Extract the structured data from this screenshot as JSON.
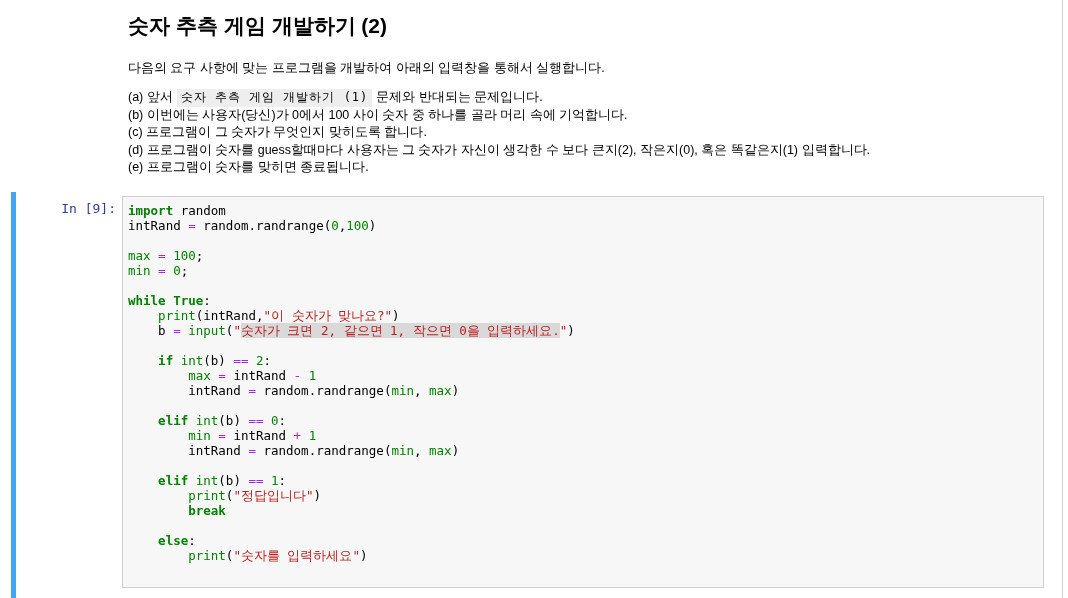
{
  "title": "숫자 추측 게임 개발하기 (2)",
  "intro": "다음의 요구 사항에 맞는 프로그램을 개발하여 아래의 입력창을 통해서 실행합니다.",
  "requirements": [
    {
      "parts": [
        {
          "kind": "text",
          "text": "(a) 앞서"
        },
        {
          "kind": "code",
          "text": "숫자 추측 게임 개발하기 (1)"
        },
        {
          "kind": "text",
          "text": "문제와 반대되는 문제입니다."
        }
      ]
    },
    {
      "parts": [
        {
          "kind": "text",
          "text": "(b) 이번에는 사용자(당신)가 0에서 100 사이 숫자 중 하나를 골라 머리 속에 기억합니다."
        }
      ]
    },
    {
      "parts": [
        {
          "kind": "text",
          "text": "(c) 프로그램이 그 숫자가 무엇인지 맞히도록 합니다."
        }
      ]
    },
    {
      "parts": [
        {
          "kind": "text",
          "text": "(d) 프로그램이 숫자를 guess할때마다 사용자는 그 숫자가 자신이 생각한 수 보다 큰지(2), 작은지(0), 혹은 똑같은지(1) 입력합니다."
        }
      ]
    },
    {
      "parts": [
        {
          "kind": "text",
          "text": "(e) 프로그램이 숫자를 맞히면 종료됩니다."
        }
      ]
    }
  ],
  "cell": {
    "prompt": "In [9]:",
    "active": true,
    "blocks": [
      [
        [
          {
            "kind": "kw",
            "text": "import"
          },
          {
            "kind": "name",
            "text": " random"
          }
        ],
        [
          {
            "kind": "name",
            "text": "intRand "
          },
          {
            "kind": "op",
            "text": "="
          },
          {
            "kind": "name",
            "text": " random.randrange("
          },
          {
            "kind": "num",
            "text": "0"
          },
          {
            "kind": "name",
            "text": ","
          },
          {
            "kind": "num",
            "text": "100"
          },
          {
            "kind": "name",
            "text": ")"
          }
        ]
      ],
      [
        [
          {
            "kind": "builtin",
            "text": "max"
          },
          {
            "kind": "op",
            "text": " ="
          },
          {
            "kind": "num",
            "text": " 100"
          },
          {
            "kind": "name",
            "text": ";"
          }
        ],
        [
          {
            "kind": "builtin",
            "text": "min"
          },
          {
            "kind": "op",
            "text": " ="
          },
          {
            "kind": "num",
            "text": " 0"
          },
          {
            "kind": "name",
            "text": ";"
          }
        ]
      ],
      [
        [
          {
            "kind": "kw",
            "text": "while"
          },
          {
            "kind": "kw",
            "text": " True"
          },
          {
            "kind": "name",
            "text": ":"
          }
        ],
        [
          {
            "kind": "builtin",
            "text": "    print"
          },
          {
            "kind": "name",
            "text": "(intRand,"
          },
          {
            "kind": "str",
            "text": "\"이 숫자가 맞나요?\""
          },
          {
            "kind": "name",
            "text": ")"
          }
        ],
        [
          {
            "kind": "name",
            "text": "    b "
          },
          {
            "kind": "op",
            "text": "="
          },
          {
            "kind": "builtin",
            "text": " input"
          },
          {
            "kind": "name",
            "text": "("
          },
          {
            "kind": "str",
            "text": "\""
          },
          {
            "kind": "str_selected",
            "text": "숫자가 크면 2, 같으면 1, 작으면 0을 입력하세요."
          },
          {
            "kind": "str",
            "text": "\""
          },
          {
            "kind": "name",
            "text": ")"
          }
        ]
      ],
      [
        [
          {
            "kind": "kw",
            "text": "    if"
          },
          {
            "kind": "builtin",
            "text": " int"
          },
          {
            "kind": "name",
            "text": "(b) "
          },
          {
            "kind": "op",
            "text": "=="
          },
          {
            "kind": "num",
            "text": " 2"
          },
          {
            "kind": "name",
            "text": ":"
          }
        ],
        [
          {
            "kind": "builtin",
            "text": "        max"
          },
          {
            "kind": "op",
            "text": " ="
          },
          {
            "kind": "name",
            "text": " intRand "
          },
          {
            "kind": "op",
            "text": "-"
          },
          {
            "kind": "num",
            "text": " 1"
          }
        ],
        [
          {
            "kind": "name",
            "text": "        intRand "
          },
          {
            "kind": "op",
            "text": "="
          },
          {
            "kind": "name",
            "text": " random.randrange("
          },
          {
            "kind": "builtin",
            "text": "min"
          },
          {
            "kind": "name",
            "text": ", "
          },
          {
            "kind": "builtin",
            "text": "max"
          },
          {
            "kind": "name",
            "text": ")"
          }
        ]
      ],
      [
        [
          {
            "kind": "kw",
            "text": "    elif"
          },
          {
            "kind": "builtin",
            "text": " int"
          },
          {
            "kind": "name",
            "text": "(b) "
          },
          {
            "kind": "op",
            "text": "=="
          },
          {
            "kind": "num",
            "text": " 0"
          },
          {
            "kind": "name",
            "text": ":"
          }
        ],
        [
          {
            "kind": "builtin",
            "text": "        min"
          },
          {
            "kind": "op",
            "text": " ="
          },
          {
            "kind": "name",
            "text": " intRand "
          },
          {
            "kind": "op",
            "text": "+"
          },
          {
            "kind": "num",
            "text": " 1"
          }
        ],
        [
          {
            "kind": "name",
            "text": "        intRand "
          },
          {
            "kind": "op",
            "text": "="
          },
          {
            "kind": "name",
            "text": " random.randrange("
          },
          {
            "kind": "builtin",
            "text": "min"
          },
          {
            "kind": "name",
            "text": ", "
          },
          {
            "kind": "builtin",
            "text": "max"
          },
          {
            "kind": "name",
            "text": ")"
          }
        ]
      ],
      [
        [
          {
            "kind": "kw",
            "text": "    elif"
          },
          {
            "kind": "builtin",
            "text": " int"
          },
          {
            "kind": "name",
            "text": "(b) "
          },
          {
            "kind": "op",
            "text": "=="
          },
          {
            "kind": "num",
            "text": " 1"
          },
          {
            "kind": "name",
            "text": ":"
          }
        ],
        [
          {
            "kind": "builtin",
            "text": "        print"
          },
          {
            "kind": "name",
            "text": "("
          },
          {
            "kind": "str",
            "text": "\"정답입니다\""
          },
          {
            "kind": "name",
            "text": ")"
          }
        ],
        [
          {
            "kind": "kw",
            "text": "        break"
          }
        ]
      ],
      [
        [
          {
            "kind": "kw",
            "text": "    else"
          },
          {
            "kind": "name",
            "text": ":"
          }
        ],
        [
          {
            "kind": "builtin",
            "text": "        print"
          },
          {
            "kind": "name",
            "text": "("
          },
          {
            "kind": "str",
            "text": "\"숫자를 입력하세요\""
          },
          {
            "kind": "name",
            "text": ")"
          }
        ]
      ]
    ]
  }
}
